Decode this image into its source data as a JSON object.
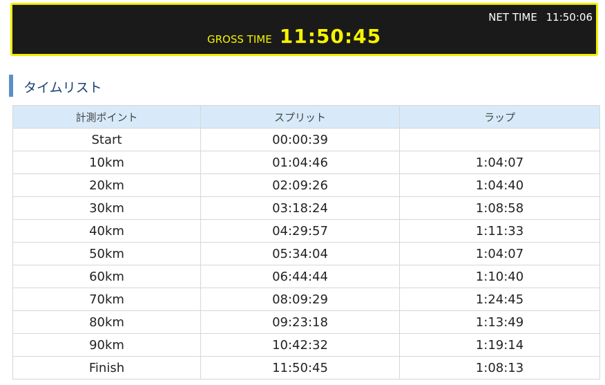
{
  "clock": {
    "net_label": "NET TIME",
    "net_value": "11:50:06",
    "gross_label": "GROSS TIME",
    "gross_value": "11:50:45"
  },
  "section": {
    "title": "タイムリスト"
  },
  "table": {
    "headers": [
      "計測ポイント",
      "スプリット",
      "ラップ"
    ],
    "rows": [
      {
        "point": "Start",
        "split": "00:00:39",
        "lap": ""
      },
      {
        "point": "10km",
        "split": "01:04:46",
        "lap": "1:04:07"
      },
      {
        "point": "20km",
        "split": "02:09:26",
        "lap": "1:04:40"
      },
      {
        "point": "30km",
        "split": "03:18:24",
        "lap": "1:08:58"
      },
      {
        "point": "40km",
        "split": "04:29:57",
        "lap": "1:11:33"
      },
      {
        "point": "50km",
        "split": "05:34:04",
        "lap": "1:04:07"
      },
      {
        "point": "60km",
        "split": "06:44:44",
        "lap": "1:10:40"
      },
      {
        "point": "70km",
        "split": "08:09:29",
        "lap": "1:24:45"
      },
      {
        "point": "80km",
        "split": "09:23:18",
        "lap": "1:13:49"
      },
      {
        "point": "90km",
        "split": "10:42:32",
        "lap": "1:19:14"
      },
      {
        "point": "Finish",
        "split": "11:50:45",
        "lap": "1:08:13"
      }
    ]
  },
  "colors": {
    "clock_border": "#f0ee00",
    "clock_background": "#1a1a1a",
    "gross_text": "#f6f300",
    "section_bar": "#5b8fc9",
    "header_background": "#d8eaf9"
  }
}
